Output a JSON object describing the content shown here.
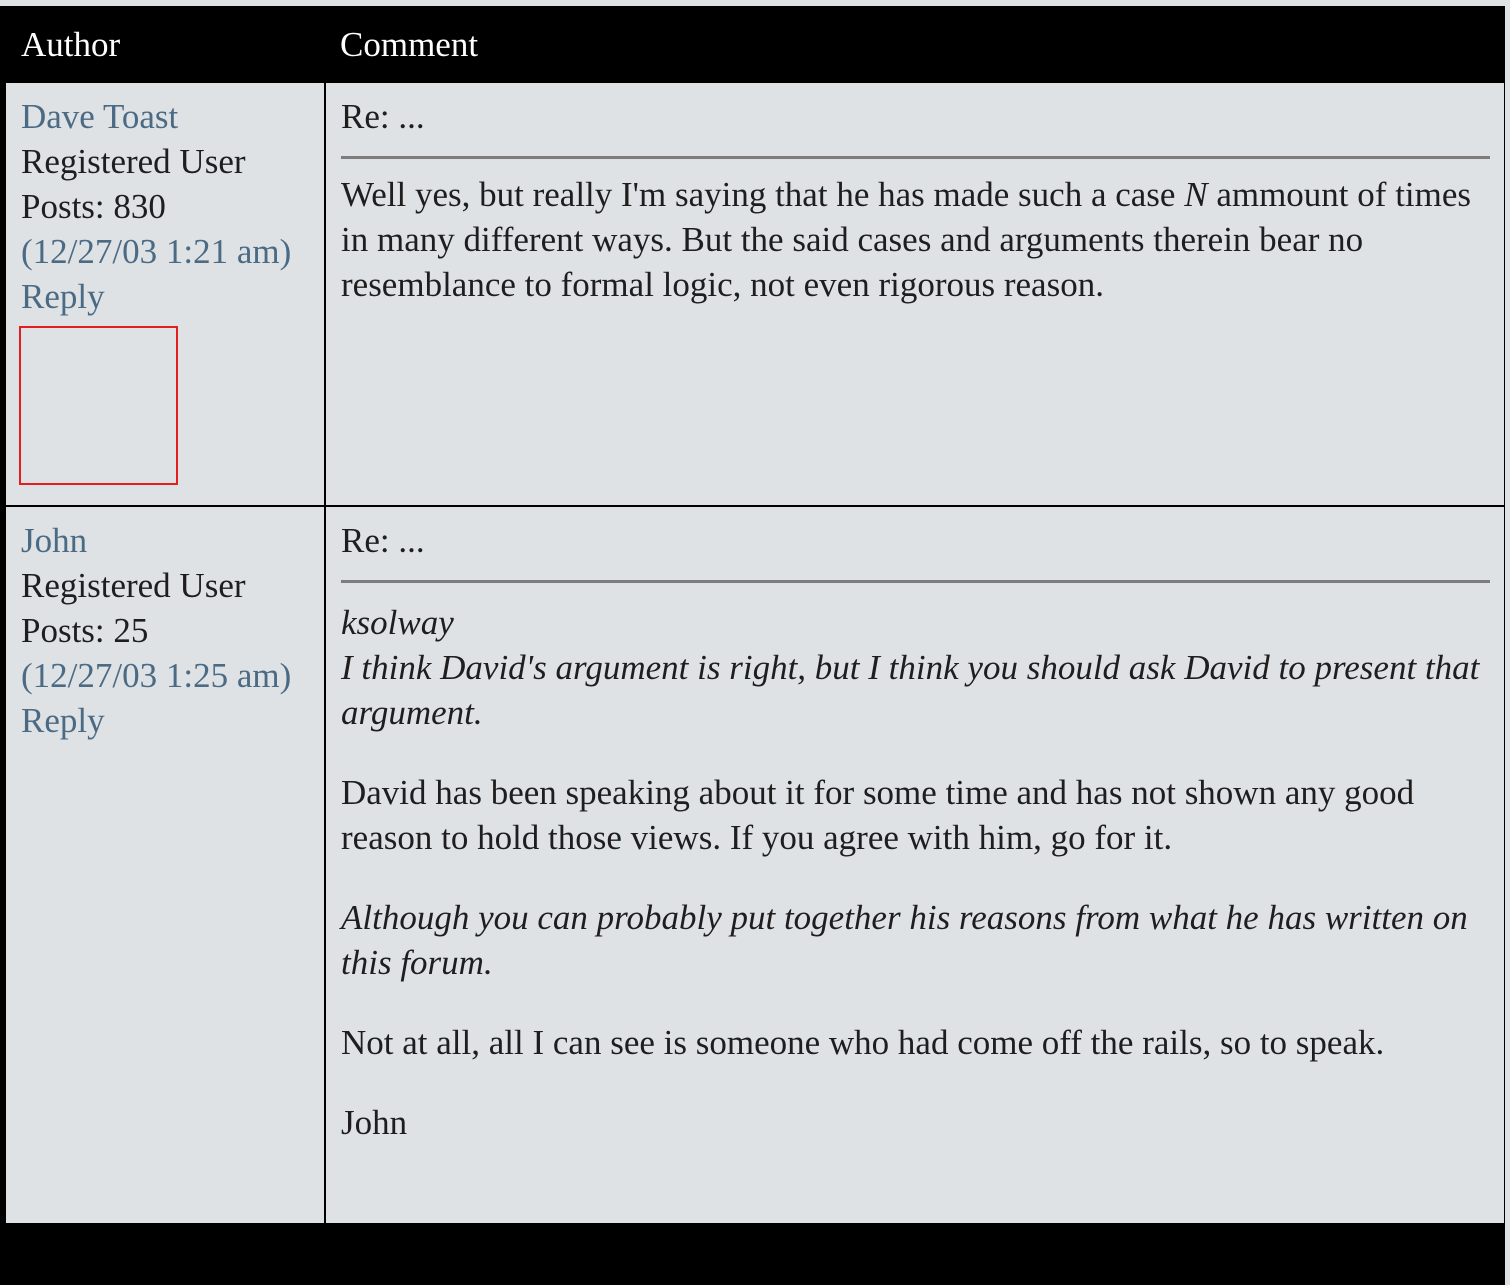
{
  "table": {
    "header": {
      "author": "Author",
      "comment": "Comment"
    }
  },
  "posts": [
    {
      "author": "Dave Toast",
      "role": "Registered User",
      "posts_count": "Posts: 830",
      "date": "(12/27/03 1:21 am)",
      "reply": "Reply",
      "subject": "Re: ...",
      "body": {
        "p1_pre": "Well yes, but really I'm saying that he has made such a case ",
        "p1_italic": "N",
        "p1_post": " ammount of times in many different ways. But the said cases and arguments therein bear no resemblance to formal logic, not even rigorous reason."
      }
    },
    {
      "author": "John",
      "role": "Registered User",
      "posts_count": "Posts: 25",
      "date": "(12/27/03 1:25 am)",
      "reply": "Reply",
      "subject": "Re: ...",
      "body": {
        "quote_author": "ksolway",
        "quote_1": "I think David's argument is right, but I think you should ask David to present that argument.",
        "reply_1": "David has been speaking about it for some time and has not shown any good reason to hold those views. If you agree with him, go for it.",
        "quote_2": "Although you can probably put together his reasons from what he has written on this forum.",
        "reply_2": "Not at all, all I can see is someone who had come off the rails, so to speak.",
        "signature": "John"
      }
    }
  ],
  "colors": {
    "link": "#4b6a84",
    "cell_background": "#dfe2e5",
    "header_background": "#000000",
    "divider": "#7c7c7c",
    "avatar_border": "#e21f1f"
  }
}
